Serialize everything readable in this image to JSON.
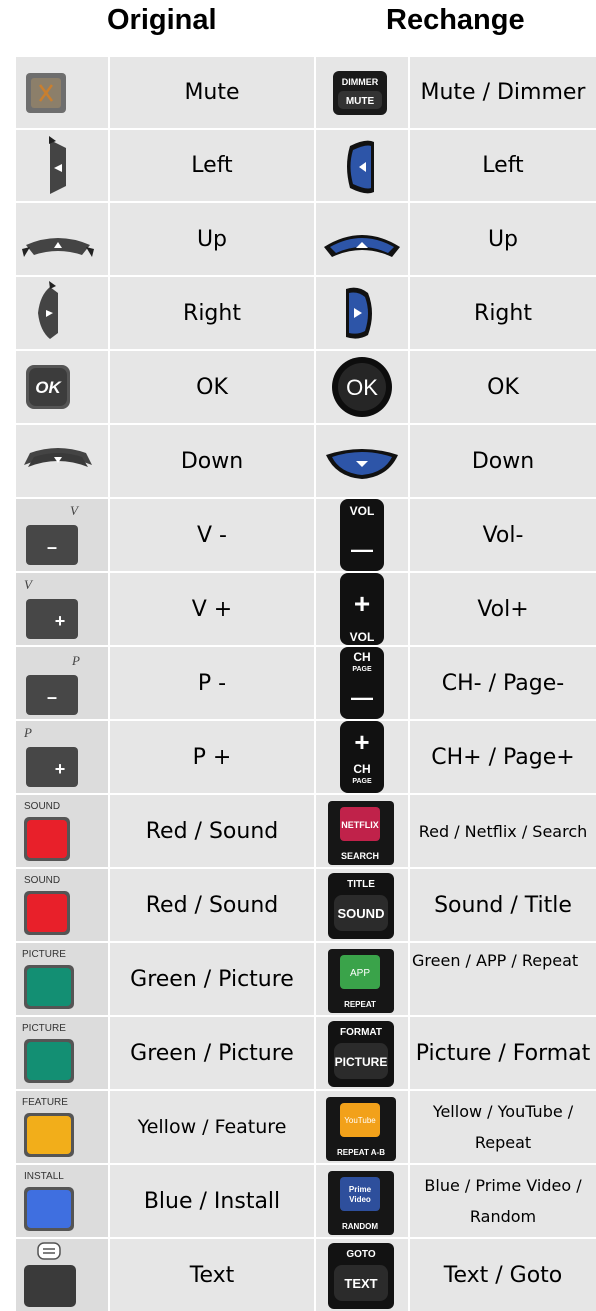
{
  "headers": {
    "original": "Original",
    "rechange": "Rechange"
  },
  "colors": {
    "cell_bg": "#e6e6e6",
    "red_key": "#e8202a",
    "green_key": "#138f73",
    "yellow_key": "#f2ae1a",
    "blue_key": "#3f6fe0",
    "remote_blue": "#2d55a8"
  },
  "rows": [
    {
      "original_label": "Mute",
      "rechange_label": "Mute / Dimmer",
      "original_icon": "mute-key-icon",
      "rechange_icon": "mute-dimmer-key-icon",
      "rechange_icon_text": [
        "DIMMER",
        "MUTE"
      ]
    },
    {
      "original_label": "Left",
      "rechange_label": "Left",
      "original_icon": "left-arrow-key-icon",
      "rechange_icon": "left-arrow-key-icon"
    },
    {
      "original_label": "Up",
      "rechange_label": "Up",
      "original_icon": "up-arrow-key-icon",
      "rechange_icon": "up-arrow-key-icon"
    },
    {
      "original_label": "Right",
      "rechange_label": "Right",
      "original_icon": "right-arrow-key-icon",
      "rechange_icon": "right-arrow-key-icon"
    },
    {
      "original_label": "OK",
      "rechange_label": "OK",
      "original_icon": "ok-key-icon",
      "rechange_icon": "ok-key-icon",
      "original_icon_text": [
        "OK"
      ],
      "rechange_icon_text": [
        "OK"
      ]
    },
    {
      "original_label": "Down",
      "rechange_label": "Down",
      "original_icon": "down-arrow-key-icon",
      "rechange_icon": "down-arrow-key-icon"
    },
    {
      "original_label": "V -",
      "rechange_label": "Vol-",
      "original_icon": "volume-down-key-icon",
      "rechange_icon": "volume-down-key-icon",
      "original_icon_text": [
        "V",
        "–"
      ],
      "rechange_icon_text": [
        "VOL",
        "—"
      ]
    },
    {
      "original_label": "V +",
      "rechange_label": "Vol+",
      "original_icon": "volume-up-key-icon",
      "rechange_icon": "volume-up-key-icon",
      "original_icon_text": [
        "V",
        "+"
      ],
      "rechange_icon_text": [
        "+",
        "VOL"
      ]
    },
    {
      "original_label": "P -",
      "rechange_label": "CH- / Page-",
      "original_icon": "program-down-key-icon",
      "rechange_icon": "channel-down-key-icon",
      "original_icon_text": [
        "P",
        "–"
      ],
      "rechange_icon_text": [
        "CH",
        "PAGE",
        "—"
      ]
    },
    {
      "original_label": "P +",
      "rechange_label": "CH+ / Page+",
      "original_icon": "program-up-key-icon",
      "rechange_icon": "channel-up-key-icon",
      "original_icon_text": [
        "P",
        "+"
      ],
      "rechange_icon_text": [
        "+",
        "CH",
        "PAGE"
      ]
    },
    {
      "original_label": "Red / Sound",
      "rechange_label": "Red / Netflix / Search",
      "original_icon": "red-sound-key-icon",
      "rechange_icon": "netflix-search-key-icon",
      "original_icon_text": [
        "SOUND"
      ],
      "rechange_icon_text": [
        "NETFLIX",
        "SEARCH"
      ]
    },
    {
      "original_label": "Red / Sound",
      "rechange_label": "Sound / Title",
      "original_icon": "red-sound-key-icon",
      "rechange_icon": "sound-title-key-icon",
      "original_icon_text": [
        "SOUND"
      ],
      "rechange_icon_text": [
        "TITLE",
        "SOUND"
      ]
    },
    {
      "original_label": "Green / Picture",
      "rechange_label": "Green / APP / Repeat",
      "original_icon": "green-picture-key-icon",
      "rechange_icon": "app-repeat-key-icon",
      "original_icon_text": [
        "PICTURE"
      ],
      "rechange_icon_text": [
        "APP",
        "REPEAT"
      ]
    },
    {
      "original_label": "Green / Picture",
      "rechange_label": "Picture / Format",
      "original_icon": "green-picture-key-icon",
      "rechange_icon": "picture-format-key-icon",
      "original_icon_text": [
        "PICTURE"
      ],
      "rechange_icon_text": [
        "FORMAT",
        "PICTURE"
      ]
    },
    {
      "original_label": "Yellow / Feature",
      "rechange_label": "Yellow / YouTube / Repeat",
      "original_icon": "yellow-feature-key-icon",
      "rechange_icon": "youtube-repeat-key-icon",
      "original_icon_text": [
        "FEATURE"
      ],
      "rechange_icon_text": [
        "YouTube",
        "REPEAT A-B"
      ]
    },
    {
      "original_label": "Blue / Install",
      "rechange_label": "Blue / Prime Video / Random",
      "original_icon": "blue-install-key-icon",
      "rechange_icon": "prime-video-random-key-icon",
      "original_icon_text": [
        "INSTALL"
      ],
      "rechange_icon_text": [
        "Prime",
        "Video",
        "RANDOM"
      ]
    },
    {
      "original_label": "Text",
      "rechange_label": "Text / Goto",
      "original_icon": "text-key-icon",
      "rechange_icon": "text-goto-key-icon",
      "rechange_icon_text": [
        "GOTO",
        "TEXT"
      ]
    }
  ]
}
